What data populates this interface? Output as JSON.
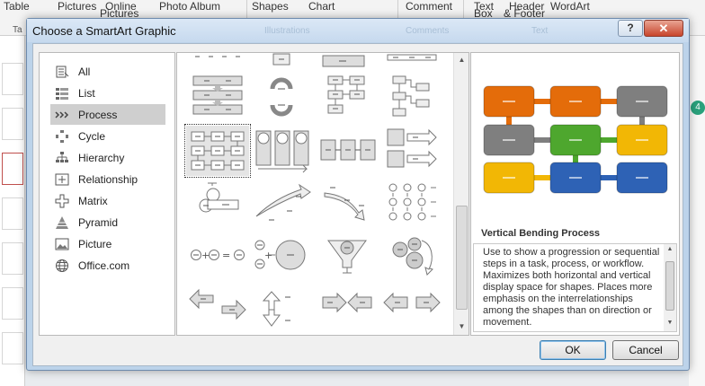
{
  "background": {
    "ribbon_items": [
      "Table",
      "Pictures",
      "Online",
      "Pictures",
      "Photo Album",
      "Shapes",
      "Chart",
      "Comment",
      "Text",
      "Box",
      "Header",
      "& Footer",
      "WordArt"
    ],
    "group_labels": [
      "Illustrations",
      "Comments",
      "Text"
    ],
    "left_tab": "Ta",
    "badge": "4"
  },
  "dialog": {
    "title": "Choose a SmartArt Graphic",
    "help_label": "?",
    "close_label": "✕",
    "categories": [
      {
        "label": "All",
        "icon": "all-icon",
        "selected": false
      },
      {
        "label": "List",
        "icon": "list-icon",
        "selected": false
      },
      {
        "label": "Process",
        "icon": "process-icon",
        "selected": true
      },
      {
        "label": "Cycle",
        "icon": "cycle-icon",
        "selected": false
      },
      {
        "label": "Hierarchy",
        "icon": "hierarchy-icon",
        "selected": false
      },
      {
        "label": "Relationship",
        "icon": "relationship-icon",
        "selected": false
      },
      {
        "label": "Matrix",
        "icon": "matrix-icon",
        "selected": false
      },
      {
        "label": "Pyramid",
        "icon": "pyramid-icon",
        "selected": false
      },
      {
        "label": "Picture",
        "icon": "picture-icon",
        "selected": false
      },
      {
        "label": "Office.com",
        "icon": "globe-icon",
        "selected": false
      }
    ],
    "preview": {
      "title": "Vertical Bending Process",
      "description": "Use to show a progression or sequential steps in a task, process, or workflow. Maximizes both horizontal and vertical display space for shapes. Places more emphasis on the interrelationships among the shapes than on direction or movement.",
      "colors": {
        "orange": "#E46C0A",
        "gray": "#7F7F7F",
        "green": "#4EA72E",
        "gold": "#F2B705",
        "blue": "#2E62B5"
      }
    },
    "ok_label": "OK",
    "cancel_label": "Cancel"
  }
}
